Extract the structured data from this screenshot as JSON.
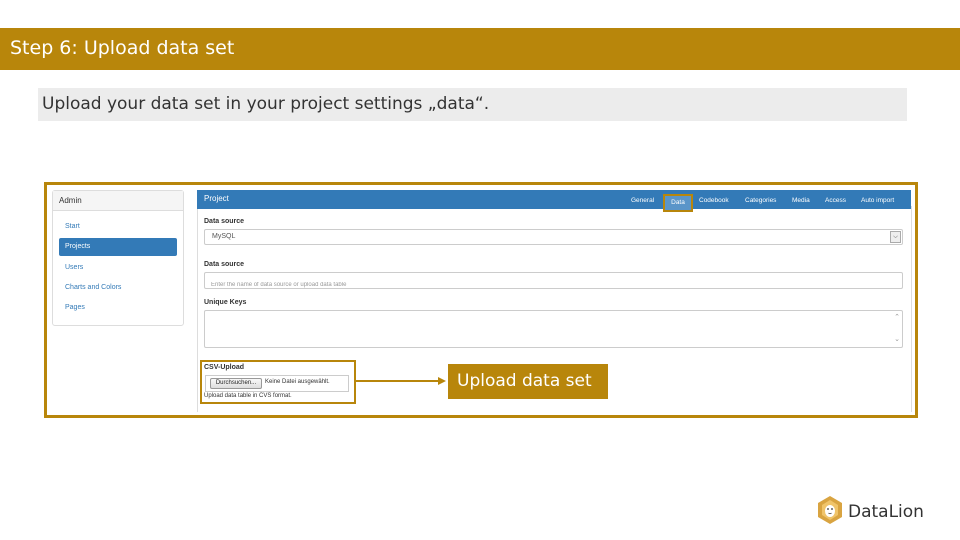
{
  "header": {
    "title": "Step 6: Upload data set"
  },
  "subtitle": "Upload your data set in your project settings „data“.",
  "admin": {
    "title": "Admin",
    "items": [
      {
        "label": "Start",
        "active": false
      },
      {
        "label": "Projects",
        "active": true
      },
      {
        "label": "Users",
        "active": false
      },
      {
        "label": "Charts and Colors",
        "active": false
      },
      {
        "label": "Pages",
        "active": false
      }
    ]
  },
  "project": {
    "title": "Project",
    "tabs": [
      "General",
      "Data",
      "Codebook",
      "Categories",
      "Media",
      "Access",
      "Auto import"
    ],
    "active_tab": "Data"
  },
  "form": {
    "data_source_label": "Data source",
    "data_source_value": "MySQL",
    "data_source2_label": "Data source",
    "data_source2_placeholder": "Enter the name of data source or upload data table",
    "unique_keys_label": "Unique Keys",
    "csv_label": "CSV-Upload",
    "file_button": "Durchsuchen...",
    "file_status": "Keine Datei ausgewählt.",
    "csv_hint": "Upload data table in CVS format."
  },
  "callout": {
    "text": "Upload data set"
  },
  "logo": {
    "text": "DataLion",
    "icon": "lion-logo-icon"
  },
  "colors": {
    "accent": "#B8860B",
    "primary": "#337ab7"
  }
}
